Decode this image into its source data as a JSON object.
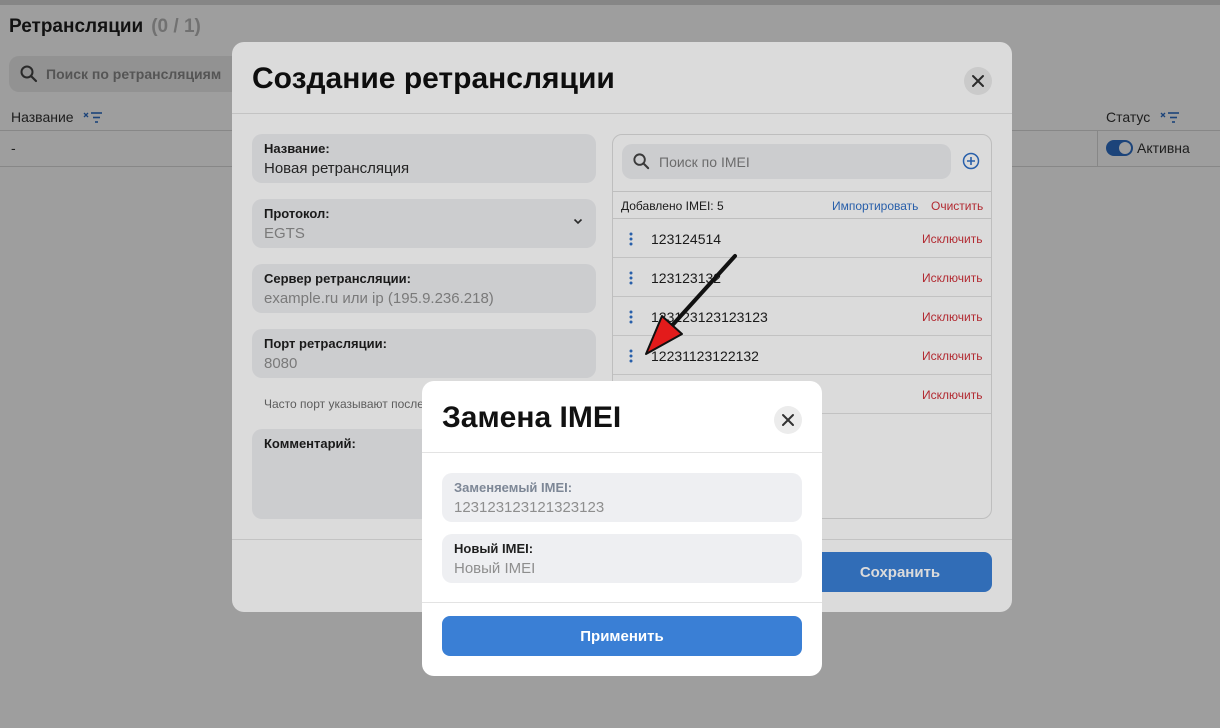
{
  "page": {
    "title": "Ретрансляции",
    "count": "(0 / 1)",
    "search_placeholder": "Поиск по ретрансляциям",
    "columns": {
      "name": "Название",
      "status": "Статус"
    },
    "row": {
      "name": "-",
      "status": "Активна",
      "active": true
    }
  },
  "create_modal": {
    "title": "Создание ретрансляции",
    "fields": {
      "name": {
        "label": "Название:",
        "value": "Новая ретрансляция"
      },
      "protocol": {
        "label": "Протокол:",
        "value": "EGTS"
      },
      "server": {
        "label": "Сервер ретрансляции:",
        "placeholder": "example.ru или ip (195.9.236.218)"
      },
      "port": {
        "label": "Порт ретрасляции:",
        "placeholder": "8080"
      },
      "port_hint": "Часто порт указывают после",
      "comment": {
        "label": "Комментарий:"
      }
    },
    "imei": {
      "search_placeholder": "Поиск по IMEI",
      "added_label": "Добавлено IMEI: 5",
      "import_label": "Импортировать",
      "clear_label": "Очистить",
      "exclude_label": "Исключить",
      "items": [
        "123124514",
        "123123132",
        "123123123123123",
        "12231123122132",
        ""
      ]
    },
    "save_label": "Сохранить"
  },
  "replace_modal": {
    "title": "Замена IMEI",
    "old_label": "Заменяемый IMEI:",
    "old_value": "123123123121323123",
    "new_label": "Новый IMEI:",
    "new_placeholder": "Новый IMEI",
    "apply_label": "Применить"
  },
  "colors": {
    "accent": "#3a7fd5",
    "danger": "#d0313a",
    "field_bg": "#eeeff2"
  },
  "icons": [
    "search-icon",
    "filter-icon",
    "close-icon",
    "chevron-down-icon",
    "plus-circle-icon",
    "kebab-icon",
    "arrow-annotation"
  ]
}
